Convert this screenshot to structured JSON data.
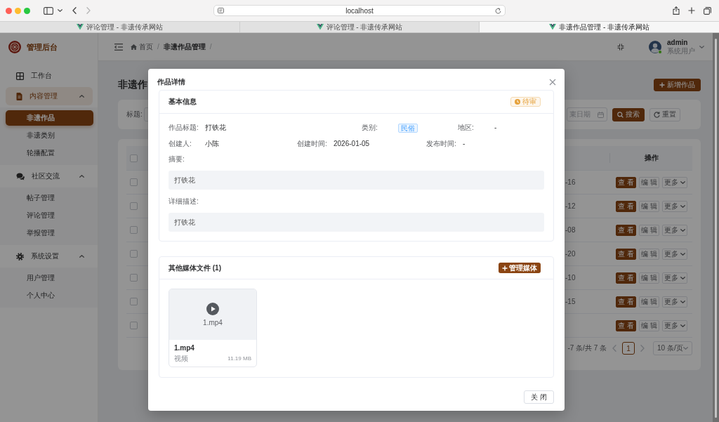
{
  "browser": {
    "address": "localhost",
    "tabs": [
      {
        "title": "评论管理 - 非遗传承网站",
        "selected": false
      },
      {
        "title": "评论管理 - 非遗传承网站",
        "selected": false
      },
      {
        "title": "非遗作品管理 - 非遗传承网站",
        "selected": true
      }
    ]
  },
  "sidebar": {
    "brand": "管理后台",
    "items": [
      {
        "kind": "item",
        "label": "工作台",
        "selected": false
      },
      {
        "kind": "group",
        "label": "内容管理",
        "expanded": true,
        "children": [
          {
            "label": "非遗作品",
            "selected": true
          },
          {
            "label": "非遗类别",
            "selected": false
          },
          {
            "label": "轮播配置",
            "selected": false
          }
        ]
      },
      {
        "kind": "group",
        "label": "社区交流",
        "expanded": true,
        "children": [
          {
            "label": "帖子管理",
            "selected": false
          },
          {
            "label": "评论管理",
            "selected": false
          },
          {
            "label": "举报管理",
            "selected": false
          }
        ]
      },
      {
        "kind": "group",
        "label": "系统设置",
        "expanded": true,
        "children": [
          {
            "label": "用户管理",
            "selected": false
          },
          {
            "label": "个人中心",
            "selected": false
          }
        ]
      }
    ]
  },
  "header": {
    "breadcrumb": [
      {
        "kind": "home",
        "label": "首页"
      },
      {
        "kind": "current",
        "label": "非遗作品管理"
      }
    ],
    "separator": "/",
    "user": {
      "name": "admin",
      "role": "系统用户",
      "online": true
    }
  },
  "page": {
    "title": "非遗作",
    "add_button": "新增作品"
  },
  "filter": {
    "title_label": "标题:",
    "end_date": {
      "placeholder": "束日期"
    },
    "search_button": "搜索",
    "reset_button": "重置"
  },
  "table": {
    "header_checked": false,
    "action_column": "操作",
    "rows": [
      {
        "checked": false,
        "date": "-16",
        "actions": [
          {
            "kind": "primary",
            "label": "查 看"
          },
          {
            "kind": "plain",
            "label": "编 辑"
          },
          {
            "kind": "dropdown",
            "label": "更多"
          }
        ]
      },
      {
        "checked": false,
        "date": "-12",
        "actions": [
          {
            "kind": "primary",
            "label": "查 看"
          },
          {
            "kind": "plain",
            "label": "编 辑"
          },
          {
            "kind": "dropdown",
            "label": "更多"
          }
        ]
      },
      {
        "checked": false,
        "date": "-08",
        "actions": [
          {
            "kind": "primary",
            "label": "查 看"
          },
          {
            "kind": "plain",
            "label": "编 辑"
          },
          {
            "kind": "dropdown",
            "label": "更多"
          }
        ]
      },
      {
        "checked": false,
        "date": "-20",
        "actions": [
          {
            "kind": "primary",
            "label": "查 看"
          },
          {
            "kind": "plain",
            "label": "编 辑"
          },
          {
            "kind": "dropdown",
            "label": "更多"
          }
        ]
      },
      {
        "checked": false,
        "date": "-10",
        "actions": [
          {
            "kind": "primary",
            "label": "查 看"
          },
          {
            "kind": "plain",
            "label": "编 辑"
          },
          {
            "kind": "dropdown",
            "label": "更多"
          }
        ]
      },
      {
        "checked": false,
        "date": "-15",
        "actions": [
          {
            "kind": "primary",
            "label": "查 看"
          },
          {
            "kind": "plain",
            "label": "编 辑"
          },
          {
            "kind": "dropdown",
            "label": "更多"
          }
        ]
      },
      {
        "checked": false,
        "actions": [
          {
            "kind": "primary",
            "label": "查 看"
          },
          {
            "kind": "plain",
            "label": "编 辑"
          },
          {
            "kind": "dropdown",
            "label": "更多"
          }
        ]
      }
    ]
  },
  "pagination": {
    "summary": "-7 条/共 7 条",
    "pages": [
      {
        "label": "1",
        "selected": true
      }
    ],
    "page_size": "10 条/页"
  },
  "modal": {
    "title": "作品详情",
    "basic": {
      "heading": "基本信息",
      "status": {
        "label": "待审",
        "kind": "warning"
      },
      "rows": [
        [
          {
            "label": "作品标题:",
            "value": "打铁花",
            "kind": "text"
          },
          {
            "label": "类别:",
            "value": "民俗",
            "kind": "tag"
          },
          {
            "label": "地区:",
            "value": "-",
            "kind": "text"
          }
        ],
        [
          {
            "label": "创建人:",
            "value": "小陈",
            "kind": "text"
          },
          {
            "label": "创建时间:",
            "value": "2026-01-05",
            "kind": "text"
          },
          {
            "label": "发布时间:",
            "value": "-",
            "kind": "text"
          }
        ]
      ],
      "summary_label": "摘要:",
      "summary": "打铁花",
      "description_label": "详细描述:",
      "description": "打铁花"
    },
    "media": {
      "heading": "其他媒体文件 (1)",
      "manage_button": "管理媒体",
      "files": [
        {
          "kind": "video",
          "preview_label": "1.mp4",
          "name": "1.mp4",
          "type": "视频",
          "size": "11.19 MB"
        }
      ]
    },
    "close_button": "关 闭"
  }
}
